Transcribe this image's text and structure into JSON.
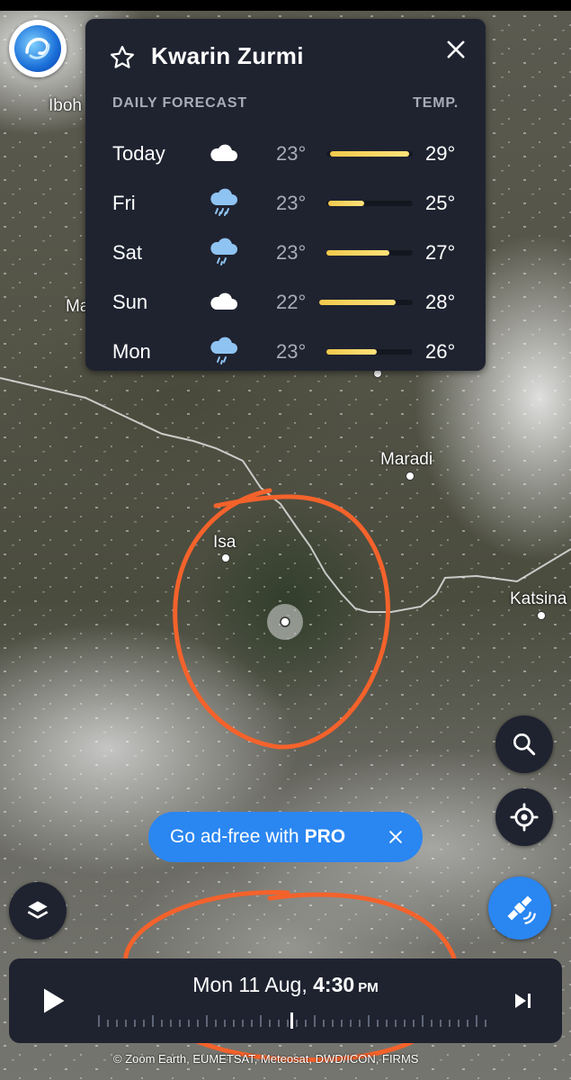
{
  "map": {
    "places": [
      {
        "name": "Iboh"
      },
      {
        "name": "Ma"
      },
      {
        "name": "Maradi"
      },
      {
        "name": "Isa"
      },
      {
        "name": "Katsina"
      }
    ],
    "attribution": "© Zoom Earth, EUMETSAT, Meteosat, DWD/ICON, FIRMS"
  },
  "forecast_panel": {
    "location": "Kwarin Zurmi",
    "section_label": "DAILY FORECAST",
    "temp_label": "TEMP.",
    "days": [
      {
        "day": "Today",
        "icon": "cloud-icon",
        "low": "23°",
        "high": "29°"
      },
      {
        "day": "Fri",
        "icon": "rain-cloud-icon",
        "low": "23°",
        "high": "25°"
      },
      {
        "day": "Sat",
        "icon": "rain-cloud-icon",
        "low": "23°",
        "high": "27°"
      },
      {
        "day": "Sun",
        "icon": "cloud-icon",
        "low": "22°",
        "high": "28°"
      },
      {
        "day": "Mon",
        "icon": "rain-cloud-icon",
        "low": "23°",
        "high": "26°"
      }
    ]
  },
  "promo": {
    "text": "Go ad-free with",
    "highlight": "PRO"
  },
  "timeline": {
    "date": "Mon 11 Aug,",
    "time": "4:30",
    "ampm": "PM"
  },
  "colors": {
    "panel_bg": "#1f2330",
    "accent_blue": "#2a86f0",
    "temp_bar": "#f2c94c",
    "annotation": "#f4622b"
  }
}
